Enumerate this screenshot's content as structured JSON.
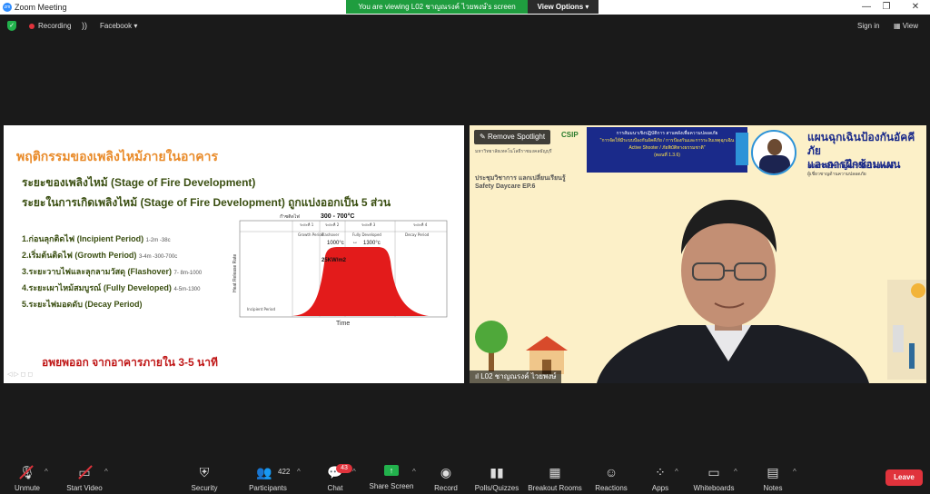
{
  "window": {
    "app_icon": "zoom",
    "title": "Zoom Meeting"
  },
  "banner": {
    "viewing_text": "You are viewing L02 ชาญณรงค์ ไวยพงษ์'s screen",
    "view_options": "View Options"
  },
  "topbar": {
    "recording": "Recording",
    "stream_target": "Facebook",
    "sign_in": "Sign in",
    "view": "View"
  },
  "slide": {
    "heading": "พฤติกรรมของเพลิงไหม้ภายในอาคาร",
    "subheading_1": "ระยะของเพลิงไหม้ (Stage of Fire Development)",
    "subheading_2": "ระยะในการเกิดเพลิงไหม้ (Stage of Fire Development) ถูกแบ่งออกเป็น 5 ส่วน",
    "stages": [
      {
        "label": "1.ก่อนลุกติดไฟ (Incipient Period)",
        "note": "1-2m -38c"
      },
      {
        "label": "2.เริ่มต้นติดไฟ (Growth Period)",
        "note": "3-4m -300-700c"
      },
      {
        "label": "3.ระยะวาบไฟและลุกลามวัสดุ (Flashover)",
        "note": "7- 8m-1000"
      },
      {
        "label": "4.ระยะเผาไหม้สมบูรณ์ (Fully Developed)",
        "note": "4-5m-1300"
      },
      {
        "label": "5.ระยะไฟมอดดับ (Decay Period)",
        "note": ""
      }
    ],
    "evacuation": "อพยพออก จากอาคารภายใน 3-5 นาที",
    "fire_chart": {
      "top_label": "ก๊าซติดไฟ",
      "temp_range": "300 - 700°C",
      "stage_headers": [
        "ระยะที่ 1",
        "ระยะที่ 2",
        "ระยะที่ 3",
        "ระยะที่ 4"
      ],
      "phase_labels": [
        "Incipient Period",
        "Growth Period",
        "Flashover",
        "Fully Developed",
        "Decay Period"
      ],
      "temp_high_left": "1000°c",
      "temp_high_right": "1300°c",
      "peak": "25KW/m2",
      "ylabel": "Heat Release Rate",
      "xlabel": "Time"
    }
  },
  "video": {
    "spotlight": "Remove Spotlight",
    "logo": "CSIP",
    "org": "มหาวิทยาลัยเทคโนโลยีราชมงคลธัญบุรี",
    "seminar_line_1": "การสัมมนาเชิงปฏิบัติการ สานพลังเพื่อความปลอดภัย",
    "seminar_line_2": "\"การจัดให้มีระบบป้องกันอัคคีภัย / การป้องกันและการระงับเหตุฉุกเฉิน",
    "seminar_line_3": "Active Shooter / ภัยพิบัติทางธรรมชาติ\"",
    "seminar_line_4": "(ตอนที่ 1.3.6)",
    "subtitle": "ประชุมวิชาการ แลกเปลี่ยนเรียนรู้ Safety Daycare EP.6",
    "plan_title_1": "แผนฉุกเฉินป้องกันอัคคีภัย",
    "plan_title_2": "และการฝึกซ้อมแผน",
    "speaker": "อาจารย์ชาญณรงค์ ไวยพงษ์",
    "speaker_sub": "ผู้เชี่ยวชาญด้านความปลอดภัย",
    "name_tag": "L02 ชาญณรงค์ ไวยพงษ์"
  },
  "toolbar": {
    "unmute": "Unmute",
    "start_video": "Start Video",
    "security": "Security",
    "participants": "Participants",
    "participants_count": "422",
    "chat": "Chat",
    "chat_badge": "43",
    "share_screen": "Share Screen",
    "record": "Record",
    "polls": "Polls/Quizzes",
    "breakout": "Breakout Rooms",
    "reactions": "Reactions",
    "apps": "Apps",
    "whiteboards": "Whiteboards",
    "notes": "Notes",
    "leave": "Leave"
  },
  "colors": {
    "accent_green": "#22b14c",
    "leave_red": "#e0333c",
    "fire_red": "#e31b1b",
    "slide_heading": "#e98b2a"
  }
}
